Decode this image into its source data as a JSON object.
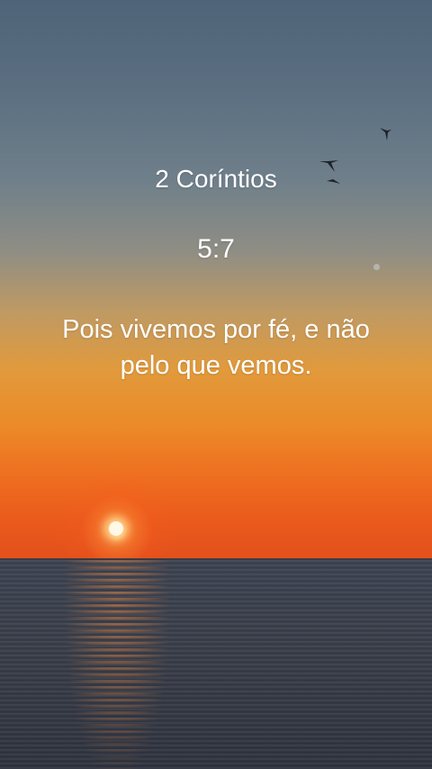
{
  "scripture": {
    "book": "2 Coríntios",
    "reference": "5:7",
    "verse": "Pois vivemos por fé, e não pelo que vemos."
  },
  "scene": {
    "icons": [
      "bird-icon",
      "bird-icon",
      "bird-icon",
      "sun-icon"
    ],
    "sky_top_color": "#4f6478",
    "sunset_color": "#ee6c1f",
    "sea_color": "#3a3f4b"
  }
}
